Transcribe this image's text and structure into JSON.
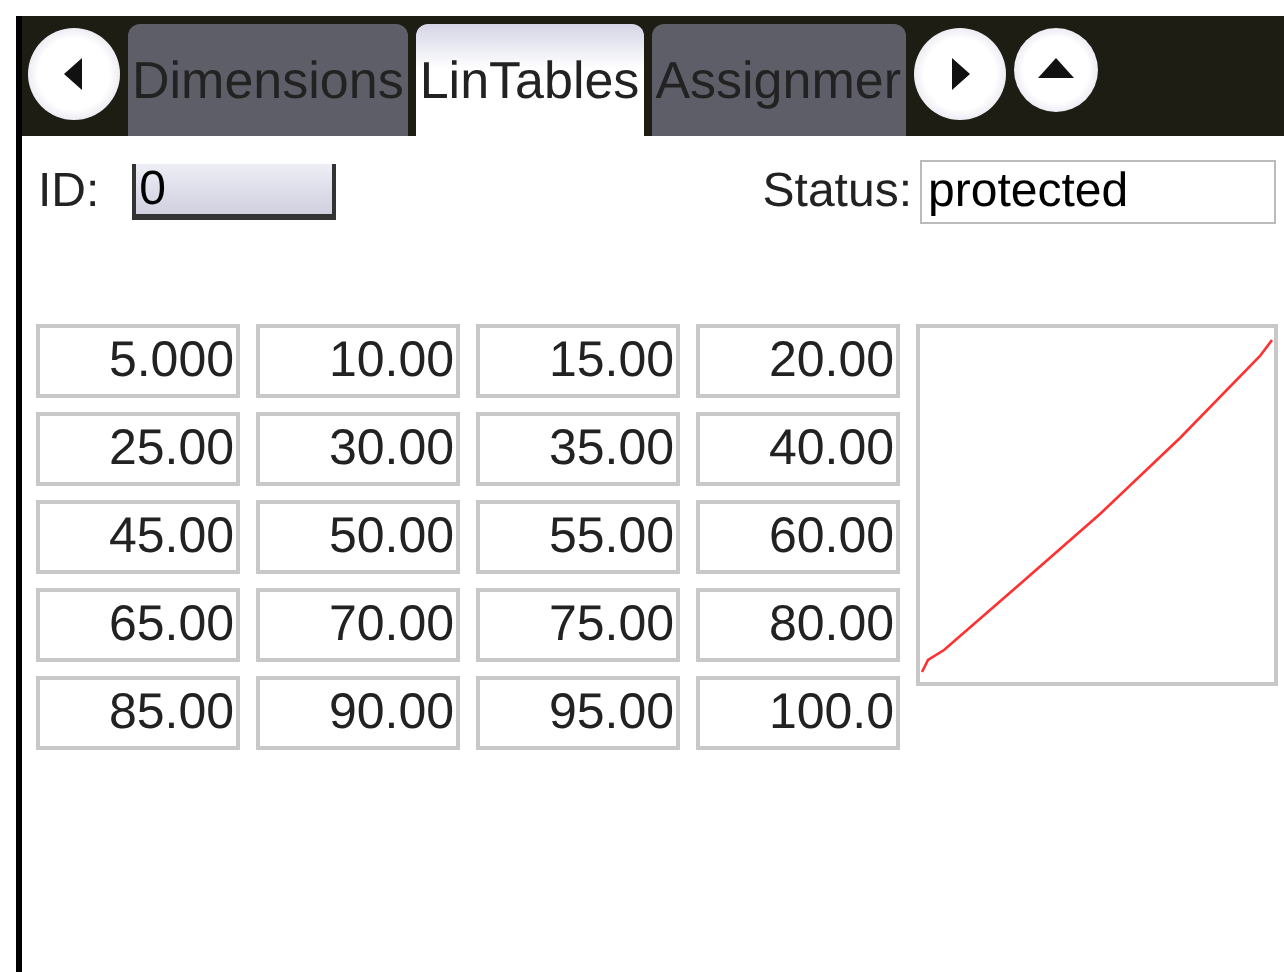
{
  "tabs": [
    {
      "label": "Dimensions",
      "selected": false
    },
    {
      "label": "LinTables",
      "selected": true
    },
    {
      "label": "Assignmer",
      "selected": false
    }
  ],
  "id_field": {
    "label": "ID:",
    "value": "0"
  },
  "status_field": {
    "label": "Status:",
    "value": "protected"
  },
  "table": {
    "rows": [
      [
        "5.000",
        "10.00",
        "15.00",
        "20.00"
      ],
      [
        "25.00",
        "30.00",
        "35.00",
        "40.00"
      ],
      [
        "45.00",
        "50.00",
        "55.00",
        "60.00"
      ],
      [
        "65.00",
        "70.00",
        "75.00",
        "80.00"
      ],
      [
        "85.00",
        "90.00",
        "95.00",
        "100.0"
      ]
    ]
  }
}
